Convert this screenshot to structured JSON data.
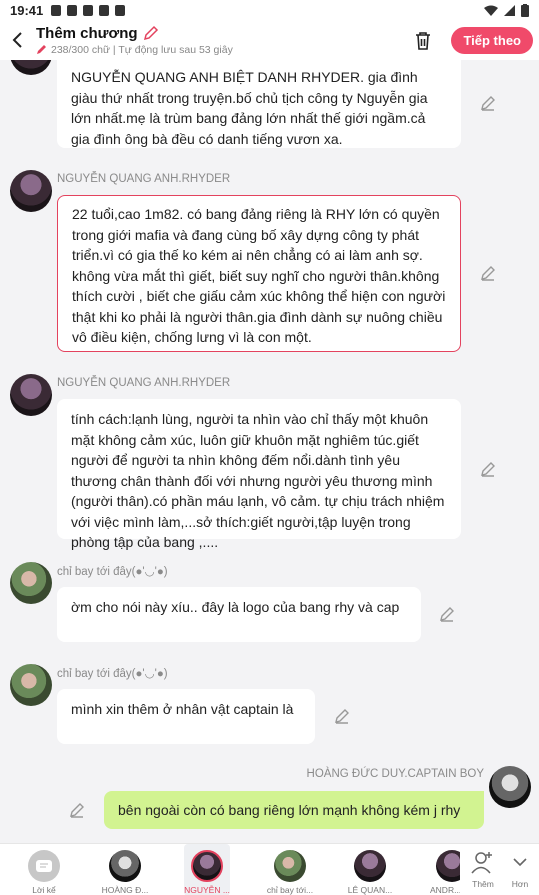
{
  "status_bar": {
    "time": "19:41"
  },
  "header": {
    "title": "Thêm chương",
    "subtitle": "238/300 chữ | Tự động lưu sau 53 giây",
    "continue_label": "Tiếp theo"
  },
  "messages": [
    {
      "name": "",
      "text": "NGUYỄN QUANG ANH BIỆT DANH RHYDER. gia đình giàu thứ nhất trong truyện.bố chủ tịch công ty Nguyễn gia lớn nhất.mẹ là trùm bang đảng lớn nhất thế giới ngầm.cả gia đình ông bà đều có danh tiếng vươn xa."
    },
    {
      "name": "NGUYỄN QUANG ANH.RHYDER",
      "text": "22 tuổi,cao 1m82. có bang đảng riêng là RHY lớn có quyền trong giới mafia và đang cùng bố xây dựng công ty phát triển.vì có gia thế ko kém ai nên chẳng có ai làm anh sợ. không vừa mắt thì giết, biết suy nghĩ cho người thân.không thích cười , biết che giấu cảm xúc không thể hiện con người thật khi ko phải là người thân.gia đình dành sự nuông chiều vô điều kiện, chống lưng vì là con một."
    },
    {
      "name": "NGUYỄN QUANG ANH.RHYDER",
      "text": "tính cách:lạnh lùng, người ta nhìn vào chỉ thấy một khuôn mặt không cảm xúc, luôn giữ khuôn mặt nghiêm túc.giết người để người ta nhìn không đếm nổi.dành tình yêu thương chân thành đối với nhưng người yêu thương mình (người thân).có phần máu lạnh, vô cảm. tự chịu trách nhiệm với việc mình làm,...sở thích:giết người,tập luyện trong phòng tập của bang ,...."
    },
    {
      "name": "chỉ bay tới đây(●'◡'●)",
      "text": "ờm cho nói này xíu.. đây là logo của bang rhy và cap"
    },
    {
      "name": "chỉ bay tới đây(●'◡'●)",
      "text": "mình xin thêm ở nhân vật captain là"
    },
    {
      "name": "HOÀNG ĐỨC DUY.CAPTAIN BOY",
      "text": "bên ngoài còn có bang riêng lớn mạnh không kém j rhy"
    }
  ],
  "bottom_bar": {
    "narrator_label": "Lời kể",
    "characters": [
      {
        "label": "HOÀNG Đ..."
      },
      {
        "label": "NGUYỄN ..."
      },
      {
        "label": "chỉ bay tới..."
      },
      {
        "label": "LÊ QUAN..."
      },
      {
        "label": "ANDR..."
      }
    ],
    "add_label": "Thêm",
    "more_label": "Hơn"
  },
  "colors": {
    "accent": "#e3425e",
    "button": "#f04a6a",
    "mine_bubble": "#d2f391"
  }
}
